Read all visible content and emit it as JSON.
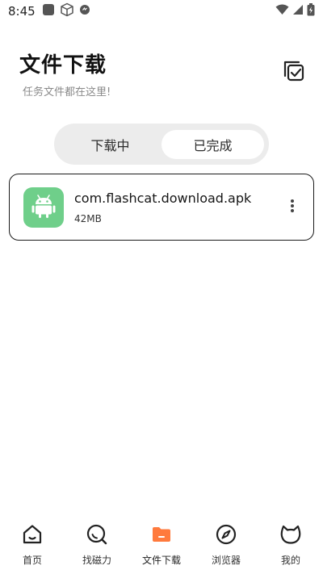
{
  "status_bar": {
    "time": "8:45",
    "icons": [
      "app-square-icon",
      "cube-icon",
      "notification-badge-icon",
      "wifi-icon",
      "signal-icon",
      "battery-charging-icon"
    ]
  },
  "header": {
    "title": "文件下载",
    "subtitle": "任务文件都在这里!",
    "action_icon": "select-all-icon"
  },
  "tabs": [
    {
      "label": "下载中",
      "active": false
    },
    {
      "label": "已完成",
      "active": true
    }
  ],
  "files": [
    {
      "name": "com.flashcat.download.apk",
      "size": "42MB",
      "icon": "android-icon"
    }
  ],
  "bottom_nav": [
    {
      "label": "首页",
      "icon": "home-icon",
      "active": false
    },
    {
      "label": "找磁力",
      "icon": "search-icon",
      "active": false
    },
    {
      "label": "文件下载",
      "icon": "folder-icon",
      "active": true
    },
    {
      "label": "浏览器",
      "icon": "compass-icon",
      "active": false
    },
    {
      "label": "我的",
      "icon": "cat-icon",
      "active": false
    }
  ],
  "colors": {
    "accent": "#ff7a3d",
    "file_icon_bg": "#6fcf8a",
    "tab_track": "#ececec"
  }
}
